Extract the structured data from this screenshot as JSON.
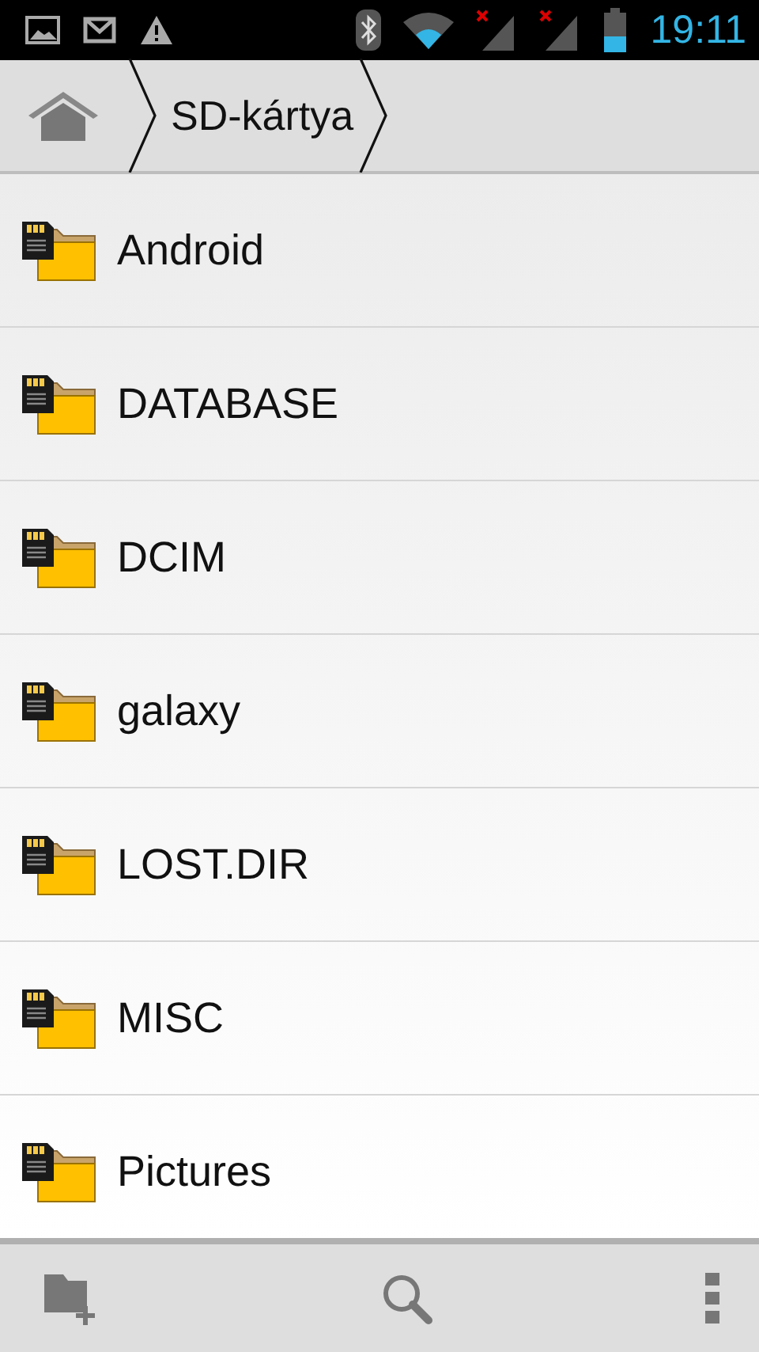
{
  "status_bar": {
    "time": "19:11"
  },
  "breadcrumb": {
    "items": [
      {
        "label": "SD-kártya"
      }
    ]
  },
  "folders": [
    {
      "name": "Android"
    },
    {
      "name": "DATABASE"
    },
    {
      "name": "DCIM"
    },
    {
      "name": "galaxy"
    },
    {
      "name": "LOST.DIR"
    },
    {
      "name": "MISC"
    },
    {
      "name": "Pictures"
    }
  ]
}
